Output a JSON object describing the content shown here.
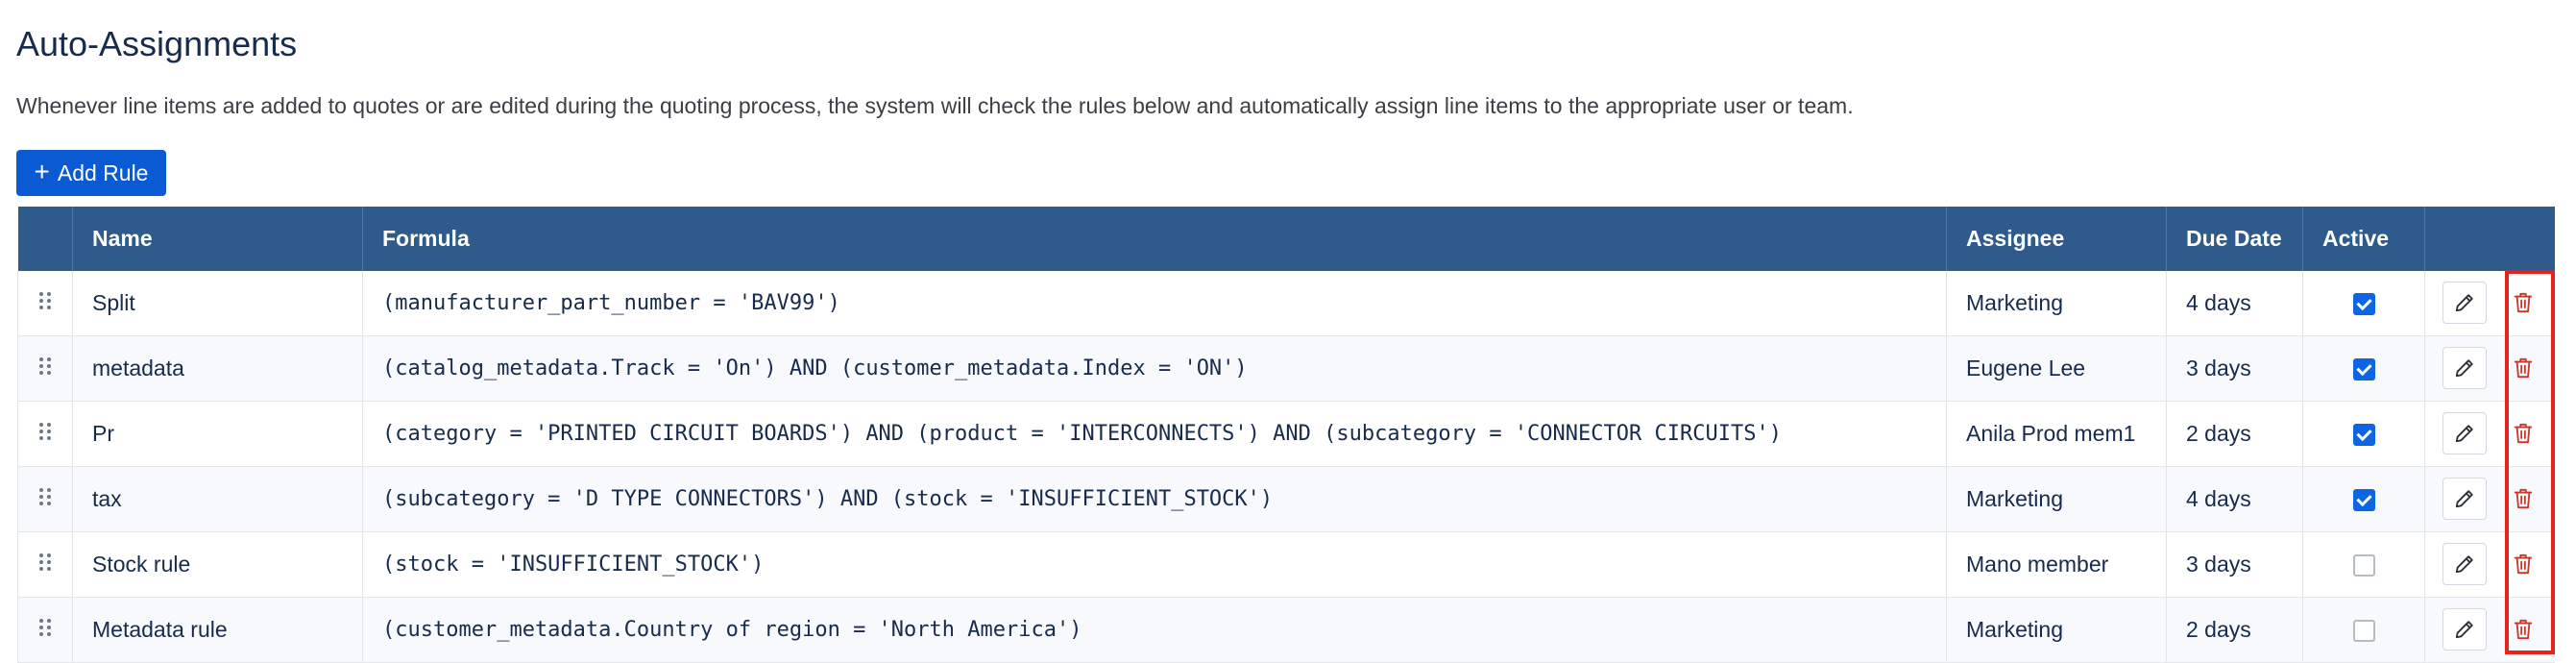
{
  "page": {
    "title": "Auto-Assignments",
    "description": "Whenever line items are added to quotes or are edited during the quoting process, the system will check the rules below and automatically assign line items to the appropriate user or team."
  },
  "toolbar": {
    "add_rule_icon": "+",
    "add_rule_label": "Add Rule"
  },
  "table": {
    "headers": {
      "handle": "",
      "name": "Name",
      "formula": "Formula",
      "assignee": "Assignee",
      "due_date": "Due Date",
      "active": "Active",
      "actions": ""
    },
    "rows": [
      {
        "name": "Split",
        "formula": "(manufacturer_part_number = 'BAV99')",
        "assignee": "Marketing",
        "due_date": "4 days",
        "active": true
      },
      {
        "name": "metadata",
        "formula": "(catalog_metadata.Track = 'On') AND (customer_metadata.Index = 'ON')",
        "assignee": "Eugene Lee",
        "due_date": "3 days",
        "active": true
      },
      {
        "name": "Pr",
        "formula": "(category = 'PRINTED CIRCUIT BOARDS') AND (product = 'INTERCONNECTS') AND (subcategory = 'CONNECTOR CIRCUITS')",
        "assignee": "Anila Prod mem1",
        "due_date": "2 days",
        "active": true
      },
      {
        "name": "tax",
        "formula": "(subcategory = 'D TYPE CONNECTORS') AND (stock = 'INSUFFICIENT_STOCK')",
        "assignee": "Marketing",
        "due_date": "4 days",
        "active": true
      },
      {
        "name": "Stock rule",
        "formula": "(stock = 'INSUFFICIENT_STOCK')",
        "assignee": "Mano member",
        "due_date": "3 days",
        "active": false
      },
      {
        "name": "Metadata rule",
        "formula": "(customer_metadata.Country of region = 'North America')",
        "assignee": "Marketing",
        "due_date": "2 days",
        "active": false
      }
    ]
  },
  "icons": {
    "handle": "drag-handle-icon",
    "edit": "pencil-icon",
    "delete": "trash-icon"
  },
  "colors": {
    "header_bg": "#2e5a8c",
    "primary": "#0a5bd3",
    "delete": "#c9372c",
    "highlight": "#e5231b"
  }
}
